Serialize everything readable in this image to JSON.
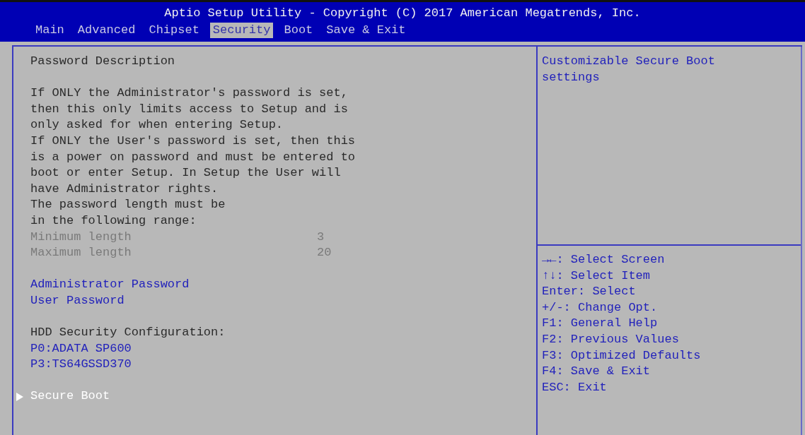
{
  "window": {
    "title": "Aptio Setup Utility - Copyright (C) 2017 American Megatrends, Inc."
  },
  "tabs": [
    {
      "label": "Main",
      "selected": false
    },
    {
      "label": "Advanced",
      "selected": false
    },
    {
      "label": "Chipset",
      "selected": false
    },
    {
      "label": "Security",
      "selected": true
    },
    {
      "label": "Boot",
      "selected": false
    },
    {
      "label": "Save & Exit",
      "selected": false
    }
  ],
  "sections": [
    {
      "items": [
        {
          "kind": "text",
          "label": "Password Description"
        }
      ]
    },
    {
      "items": [
        {
          "kind": "text",
          "label": "If ONLY the Administrator's password is set,"
        },
        {
          "kind": "text",
          "label": "then this only limits access to Setup and is"
        },
        {
          "kind": "text",
          "label": "only asked for when entering Setup."
        },
        {
          "kind": "text",
          "label": "If ONLY the User's password is set, then this"
        },
        {
          "kind": "text",
          "label": "is a power on password and must be entered to"
        },
        {
          "kind": "text",
          "label": "boot or enter Setup. In Setup the User will"
        },
        {
          "kind": "text",
          "label": "have Administrator rights."
        },
        {
          "kind": "text",
          "label": "The password length must be"
        },
        {
          "kind": "text",
          "label": "in the following range:"
        },
        {
          "kind": "info",
          "label": "Minimum length",
          "value": "3"
        },
        {
          "kind": "info",
          "label": "Maximum length",
          "value": "20"
        }
      ]
    },
    {
      "items": [
        {
          "kind": "option",
          "label": "Administrator Password",
          "selected": false
        },
        {
          "kind": "option",
          "label": "User Password",
          "selected": false
        }
      ]
    },
    {
      "items": [
        {
          "kind": "text",
          "label": "HDD Security Configuration:"
        },
        {
          "kind": "option",
          "label": "P0:ADATA SP600",
          "selected": false
        },
        {
          "kind": "option",
          "label": "P3:TS64GSSD370",
          "selected": false
        }
      ]
    },
    {
      "items": [
        {
          "kind": "submenu",
          "label": "Secure Boot",
          "selected": true
        }
      ]
    }
  ],
  "help": "Customizable Secure Boot settings",
  "keys": [
    "→←: Select Screen",
    "↑↓: Select Item",
    "Enter: Select",
    "+/-: Change Opt.",
    "F1: General Help",
    "F2: Previous Values",
    "F3: Optimized Defaults",
    "F4: Save & Exit",
    "ESC: Exit"
  ]
}
